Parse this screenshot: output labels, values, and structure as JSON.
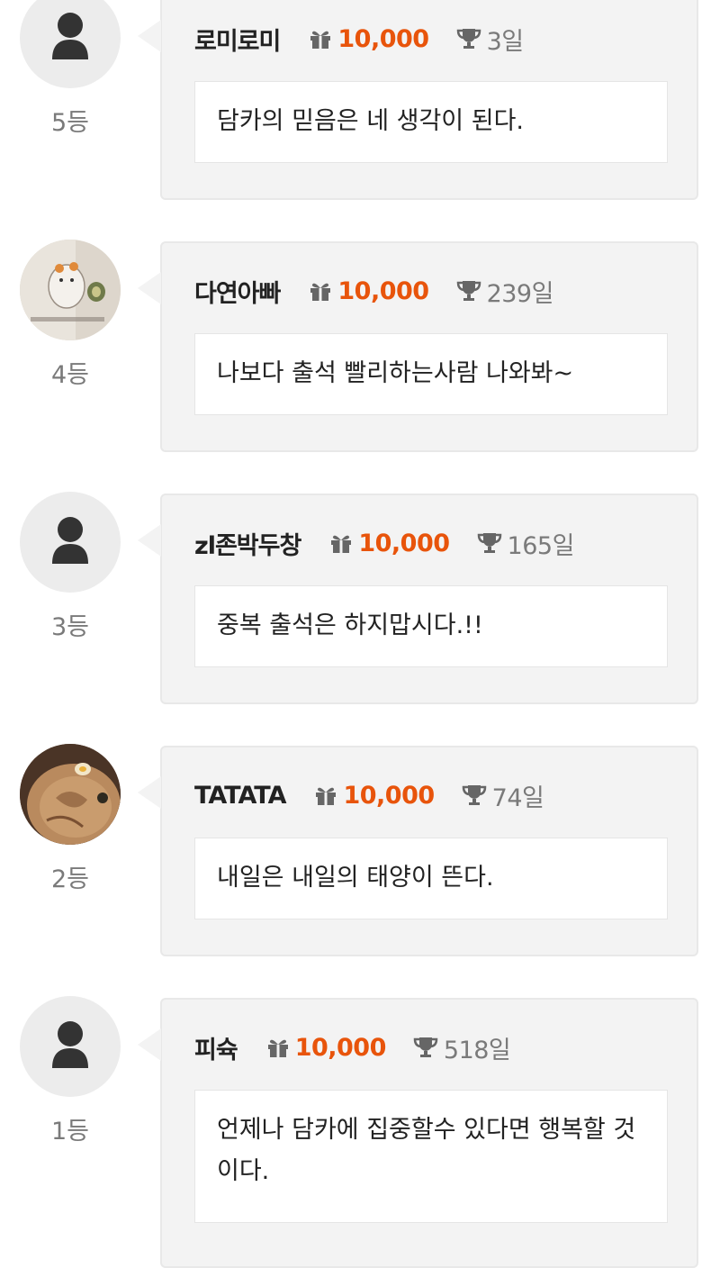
{
  "entries": [
    {
      "rank": "5등",
      "nickname": "로미로미",
      "points": "10,000",
      "days": "3일",
      "message": "담카의 믿음은 네 생각이 된다.",
      "avatar": "default-avatar"
    },
    {
      "rank": "4등",
      "nickname": "다연아빠",
      "points": "10,000",
      "days": "239일",
      "message": "나보다 출석 빨리하는사람 나와봐~",
      "avatar": "photo-hamster"
    },
    {
      "rank": "3등",
      "nickname": "zl존박두창",
      "points": "10,000",
      "days": "165일",
      "message": "중복 출석은 하지맙시다.!!",
      "avatar": "default-avatar"
    },
    {
      "rank": "2등",
      "nickname": "TATATA",
      "points": "10,000",
      "days": "74일",
      "message": "내일은 내일의 태양이 뜬다.",
      "avatar": "photo-food"
    },
    {
      "rank": "1등",
      "nickname": "피슉",
      "points": "10,000",
      "days": "518일",
      "message": "언제나 담카에 집중할수 있다면 행복할 것이다.",
      "avatar": "default-avatar"
    }
  ],
  "icons": {
    "gift": "gift-icon",
    "trophy": "trophy-icon",
    "user": "user-icon"
  },
  "colors": {
    "points": "#e8540b",
    "card_bg": "#f3f3f3",
    "muted": "#7a7a7a"
  }
}
